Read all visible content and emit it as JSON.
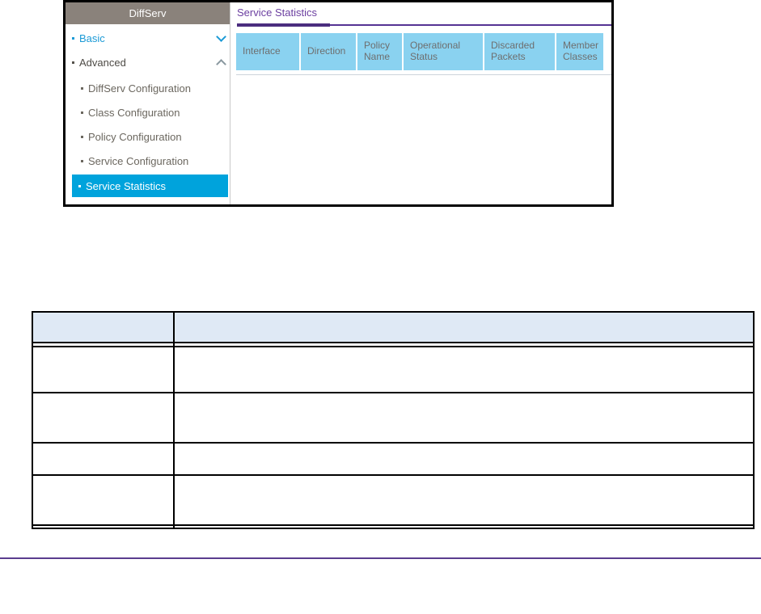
{
  "figure": {
    "sidebar": {
      "title": "DiffServ",
      "items": [
        "Basic",
        "Advanced",
        "DiffServ Configuration",
        "Class Configuration",
        "Policy Configuration",
        "Service Configuration",
        "Service Statistics"
      ]
    },
    "main": {
      "title": "Service Statistics",
      "columns": [
        "Interface",
        "Direction",
        "Policy Name",
        "Operational Status",
        "Discarded Packets",
        "Member Classes"
      ]
    }
  },
  "doc_table": {
    "header": [
      "",
      ""
    ],
    "rows": [
      [
        "",
        ""
      ],
      [
        "",
        ""
      ],
      [
        "",
        ""
      ],
      [
        "",
        ""
      ]
    ]
  },
  "colors": {
    "selected_item_bg": "#00a3dc",
    "link_blue": "#1b9ad6",
    "sidebar_header_bg": "#8a827b",
    "figure_table_header_bg": "#8ad2f0",
    "title_purple": "#6b3fa0",
    "title_rule_purple": "#4b2d7f",
    "footer_rule_purple": "#5a3d8e",
    "doc_table_header_fill": "#dfe9f5"
  }
}
